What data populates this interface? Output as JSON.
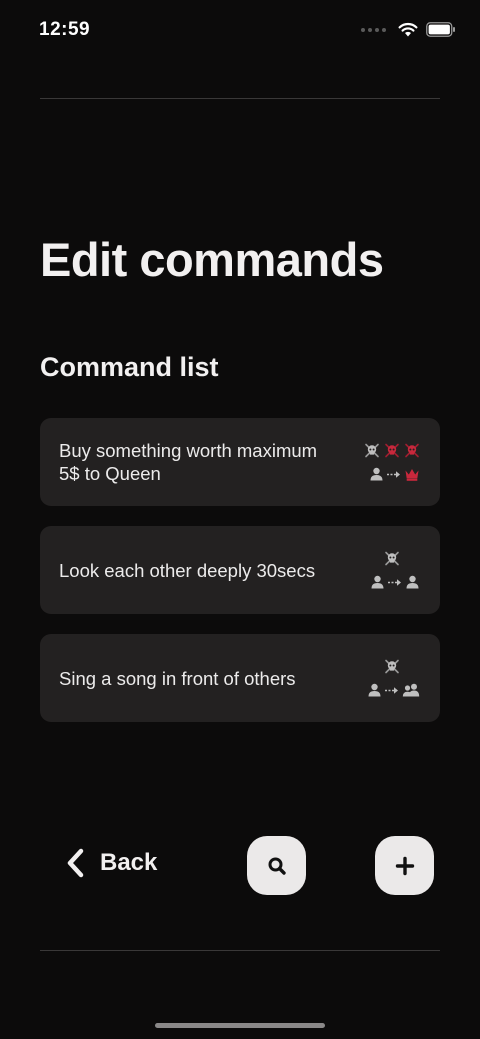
{
  "status_bar": {
    "time": "12:59"
  },
  "page": {
    "title": "Edit commands",
    "section_title": "Command list"
  },
  "commands": [
    {
      "text": "Buy something worth maximum 5$ to Queen",
      "skulls": 3,
      "skull_colors": [
        "#bfbfbf",
        "#c8283c",
        "#c8283c"
      ],
      "from": "person-icon",
      "to": "crown-icon",
      "to_color": "#c8283c"
    },
    {
      "text": "Look each other deeply 30secs",
      "skulls": 1,
      "skull_colors": [
        "#bfbfbf"
      ],
      "from": "person-icon",
      "to": "person-icon",
      "to_color": "#bfbfbf"
    },
    {
      "text": "Sing a song in front of others",
      "skulls": 1,
      "skull_colors": [
        "#bfbfbf"
      ],
      "from": "person-icon",
      "to": "group-icon",
      "to_color": "#bfbfbf"
    }
  ],
  "bottom_bar": {
    "back_label": "Back",
    "search_icon": "search-icon",
    "add_icon": "plus-icon"
  },
  "colors": {
    "background": "#0c0b0b",
    "card": "#232121",
    "accent_red": "#c8283c",
    "button_bg": "#ebe9e9"
  }
}
